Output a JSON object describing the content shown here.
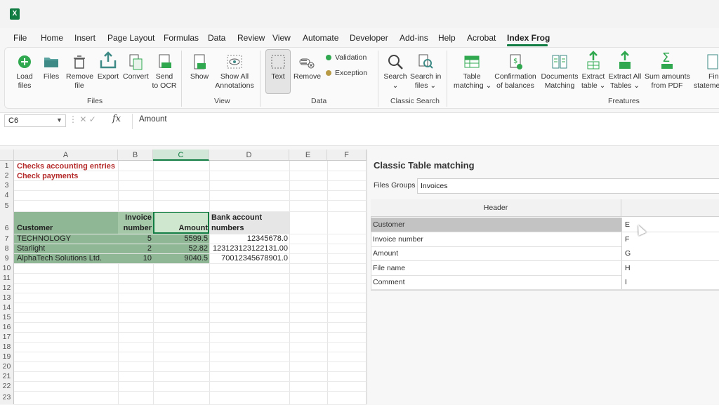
{
  "menu": [
    "File",
    "Home",
    "Insert",
    "Page Layout",
    "Formulas",
    "Data",
    "Review",
    "View",
    "Automate",
    "Developer",
    "Add-ins",
    "Help",
    "Acrobat",
    "Index Frog"
  ],
  "ribbon": {
    "files": {
      "group": "Files",
      "load": [
        "Load",
        "files"
      ],
      "files": "Files",
      "remove": [
        "Remove",
        "file"
      ],
      "export": "Export",
      "convert": "Convert",
      "send": [
        "Send",
        "to OCR"
      ]
    },
    "view": {
      "group": "View",
      "show": "Show",
      "show_all": [
        "Show All",
        "Annotations"
      ]
    },
    "data": {
      "group": "Data",
      "text": "Text",
      "remove": "Remove",
      "validation": "Validation",
      "exception": "Exception"
    },
    "search": {
      "group": "Classic Search",
      "search": [
        "Search",
        "⌄"
      ],
      "search_in": [
        "Search in",
        "files ⌄"
      ]
    },
    "features": {
      "group": "Freatures",
      "table_matching": [
        "Table",
        "matching ⌄"
      ],
      "confirmation": [
        "Confirmation",
        "of balances"
      ],
      "documents": [
        "Documents",
        "Matching"
      ],
      "extract_table": [
        "Extract",
        "table ⌄"
      ],
      "extract_all": [
        "Extract All",
        "Tables ⌄"
      ],
      "sum_amounts": [
        "Sum amounts",
        "from PDF"
      ],
      "fin": [
        "Fin",
        "stateme"
      ]
    }
  },
  "colors": {
    "accent": "#107c41",
    "validation": "#2fa84f",
    "exception": "#b89a45",
    "selected_fill": "#8fb795",
    "header_fill": "#a4c8a8"
  },
  "formula_bar": {
    "cell_ref": "C6",
    "fx": "fx",
    "value": "Amount"
  },
  "sheet": {
    "columns": [
      "A",
      "B",
      "C",
      "D",
      "E",
      "F"
    ],
    "rows": [
      "1",
      "2",
      "3",
      "4",
      "5",
      "6",
      "7",
      "8",
      "9",
      "10",
      "11",
      "12",
      "13",
      "14",
      "15",
      "16",
      "17",
      "18",
      "19",
      "20",
      "21",
      "22",
      "23"
    ],
    "title1": "Checks accounting entries",
    "title2": "Check payments",
    "headers": {
      "customer": "Customer",
      "invoice1": "Invoice",
      "invoice2": "number",
      "amount": "Amount",
      "bank1": "Bank account",
      "bank2": "numbers"
    },
    "data": [
      {
        "customer": "TECHNOLOGY",
        "invoice": "5",
        "amount": "5599.5",
        "bank": "12345678.0"
      },
      {
        "customer": "Starlight",
        "invoice": "2",
        "amount": "52.82",
        "bank": "123123123122131.00"
      },
      {
        "customer": "AlphaTech Solutions Ltd.",
        "invoice": "10",
        "amount": "9040.5",
        "bank": "70012345678901.0"
      }
    ]
  },
  "panel": {
    "title": "Classic Table matching",
    "files_groups_label": "Files Groups",
    "files_groups_value": "Invoices",
    "header_label": "Header",
    "rows": [
      {
        "name": "Customer",
        "value": "E"
      },
      {
        "name": "Invoice number",
        "value": "F"
      },
      {
        "name": "Amount",
        "value": "G"
      },
      {
        "name": "File name",
        "value": "H"
      },
      {
        "name": "Comment",
        "value": "I"
      }
    ]
  }
}
